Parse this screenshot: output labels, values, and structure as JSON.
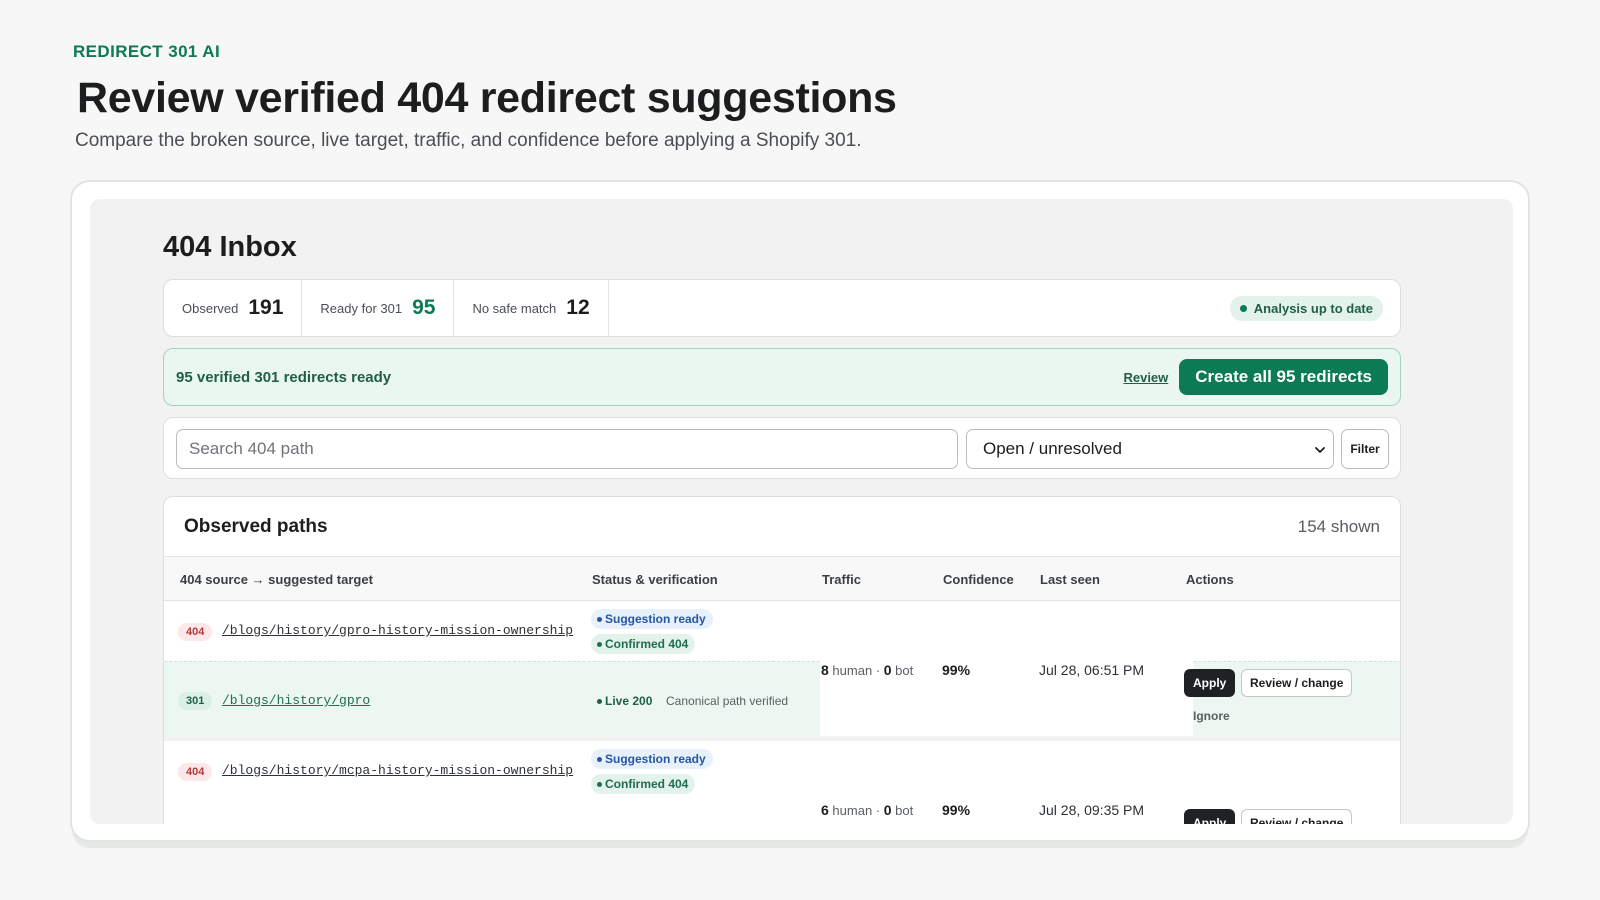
{
  "app": {
    "eyebrow": "REDIRECT 301 AI"
  },
  "hero": {
    "title": "Review verified 404 redirect suggestions",
    "subtitle": "Compare the broken source, live target, traffic, and confidence before applying a Shopify 301."
  },
  "inbox": {
    "title": "404 Inbox",
    "stats": [
      {
        "label": "Observed",
        "value": "191"
      },
      {
        "label": "Ready for 301",
        "value": "95"
      },
      {
        "label": "No safe match",
        "value": "12"
      }
    ],
    "analysis_status": "Analysis up to date",
    "banner": {
      "text": "95 verified 301 redirects ready",
      "review_link": "Review",
      "create_button": "Create all 95 redirects"
    },
    "filters": {
      "search_placeholder": "Search 404 path",
      "status_select": "Open / unresolved",
      "filter_button": "Filter"
    },
    "table": {
      "title": "Observed paths",
      "count": "154 shown",
      "columns": [
        "404 source → suggested target",
        "Status & verification",
        "Traffic",
        "Confidence",
        "Last seen",
        "Actions"
      ],
      "rows": [
        {
          "source_badge": "404",
          "source_path": "/blogs/history/gpro-history-mission-ownership",
          "status_1": "Suggestion ready",
          "status_2": "Confirmed 404",
          "target_badge": "301",
          "target_path": "/blogs/history/gpro",
          "target_status": "Live 200",
          "target_note": "Canonical path verified",
          "human": "8",
          "human_label": "human",
          "bot": "0",
          "bot_label": "bot",
          "confidence": "99%",
          "last_seen": "Jul 28, 06:51 PM",
          "apply": "Apply",
          "review_change": "Review / change",
          "ignore": "Ignore"
        },
        {
          "source_badge": "404",
          "source_path": "/blogs/history/mcpa-history-mission-ownership",
          "status_1": "Suggestion ready",
          "status_2": "Confirmed 404",
          "human": "6",
          "human_label": "human",
          "bot": "0",
          "bot_label": "bot",
          "confidence": "99%",
          "last_seen": "Jul 28, 09:35 PM",
          "apply": "Apply",
          "review_change": "Review / change"
        }
      ]
    }
  }
}
